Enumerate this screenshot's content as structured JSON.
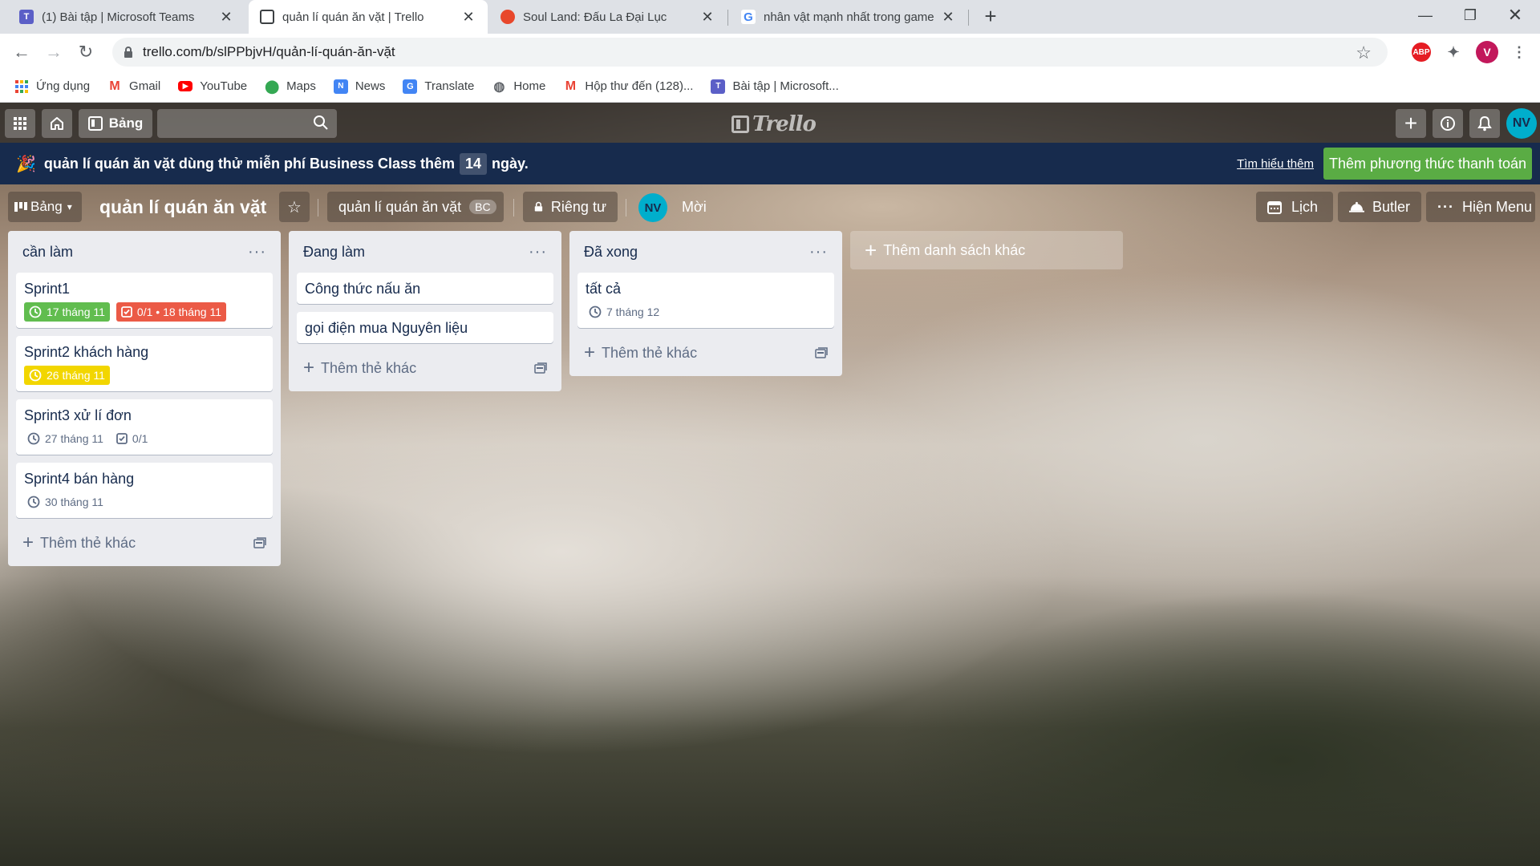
{
  "browser": {
    "tabs": [
      {
        "title": "(1) Bài tập | Microsoft Teams",
        "icon": "teams-icon",
        "active": false
      },
      {
        "title": "quản lí quán ăn vặt | Trello",
        "icon": "trello-icon",
        "active": true
      },
      {
        "title": "Soul Land: Đấu La Đại Lục",
        "icon": "soul-land-icon",
        "active": false
      },
      {
        "title": "nhân vật mạnh nhất trong game",
        "icon": "google-icon",
        "active": false
      }
    ],
    "url": "trello.com/b/slPPbjvH/quản-lí-quán-ăn-vặt",
    "profile_initial": "V",
    "abp_label": "ABP",
    "bookmarks": [
      {
        "label": "Ứng dụng",
        "icon": "apps-grid-icon"
      },
      {
        "label": "Gmail",
        "icon": "gmail-icon"
      },
      {
        "label": "YouTube",
        "icon": "youtube-icon"
      },
      {
        "label": "Maps",
        "icon": "maps-icon"
      },
      {
        "label": "News",
        "icon": "news-icon"
      },
      {
        "label": "Translate",
        "icon": "translate-icon"
      },
      {
        "label": "Home",
        "icon": "home-globe-icon"
      },
      {
        "label": "Hộp thư đến (128)...",
        "icon": "gmail-icon"
      },
      {
        "label": "Bài tập | Microsoft...",
        "icon": "teams-icon"
      }
    ]
  },
  "trello": {
    "header": {
      "boards_label": "Bảng",
      "search_placeholder": "",
      "logo_text": "Trello",
      "avatar_initials": "NV"
    },
    "banner": {
      "message_before": "quản lí quán ăn vặt dùng thử miễn phí Business Class thêm",
      "days": "14",
      "message_after": "ngày.",
      "learn_more": "Tìm hiểu thêm",
      "add_payment": "Thêm phương thức thanh toán"
    },
    "board": {
      "view_label": "Bảng",
      "title": "quản lí quán ăn vặt",
      "workspace": "quản lí quán ăn vặt",
      "workspace_badge": "BC",
      "visibility": "Riêng tư",
      "member_initials": "NV",
      "invite": "Mời",
      "calendar": "Lịch",
      "butler": "Butler",
      "show_menu": "Hiện Menu"
    },
    "lists": [
      {
        "title": "cần làm",
        "add_card": "Thêm thẻ khác",
        "cards": [
          {
            "title": "Sprint1",
            "badges": [
              {
                "type": "due",
                "text": "17 tháng 11",
                "style": "green"
              },
              {
                "type": "checklist",
                "text": "0/1 • 18 tháng 11",
                "style": "red"
              }
            ]
          },
          {
            "title": "Sprint2 khách hàng",
            "badges": [
              {
                "type": "due",
                "text": "26 tháng 11",
                "style": "yellow"
              }
            ]
          },
          {
            "title": "Sprint3 xử lí đơn",
            "badges": [
              {
                "type": "due",
                "text": "27 tháng 11",
                "style": "plain"
              },
              {
                "type": "checklist",
                "text": "0/1",
                "style": "plain"
              }
            ]
          },
          {
            "title": "Sprint4 bán hàng",
            "badges": [
              {
                "type": "due",
                "text": "30 tháng 11",
                "style": "plain"
              }
            ]
          }
        ]
      },
      {
        "title": "Đang làm",
        "add_card": "Thêm thẻ khác",
        "cards": [
          {
            "title": "Công thức nấu ăn",
            "badges": []
          },
          {
            "title": "gọi điện mua Nguyên liệu",
            "badges": []
          }
        ]
      },
      {
        "title": "Đã xong",
        "add_card": "Thêm thẻ khác",
        "cards": [
          {
            "title": "tất cả",
            "badges": [
              {
                "type": "due",
                "text": "7 tháng 12",
                "style": "plain"
              }
            ]
          }
        ]
      }
    ],
    "add_list": "Thêm danh sách khác"
  },
  "colors": {
    "trello_header": "#3a3a3a",
    "banner_bg": "#172b4d",
    "payment_button": "#5aac44",
    "label_green": "#61bd4f",
    "label_red": "#eb5a46",
    "label_yellow": "#f2d600",
    "avatar": "#00aecc"
  }
}
